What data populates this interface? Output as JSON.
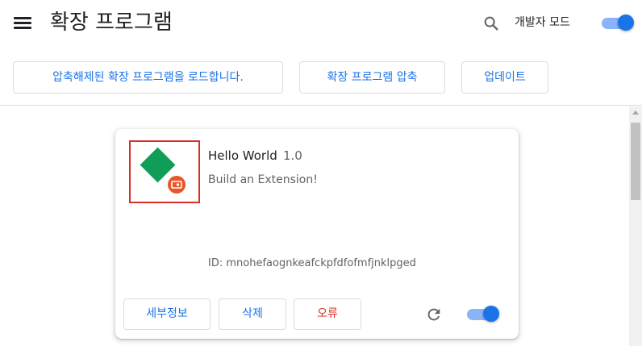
{
  "header": {
    "title": "확장 프로그램",
    "dev_mode_label": "개발자 모드",
    "dev_mode_on": true
  },
  "toolbar": {
    "load_unpacked": "압축해제된 확장 프로그램을 로드합니다.",
    "pack": "확장 프로그램 압축",
    "update": "업데이트"
  },
  "extension": {
    "name": "Hello World",
    "version": "1.0",
    "description": "Build an Extension!",
    "id": "ID: mnohefaognkeafckpfdfofmfjnklpged",
    "details_label": "세부정보",
    "remove_label": "삭제",
    "errors_label": "오류",
    "enabled": true
  },
  "colors": {
    "accent": "#1a73e8",
    "error": "#d93025",
    "icon_green": "#0f9d58",
    "badge_orange": "#e8562a"
  },
  "icons": [
    "menu-icon",
    "search-icon",
    "extension-icon",
    "reload-icon"
  ]
}
